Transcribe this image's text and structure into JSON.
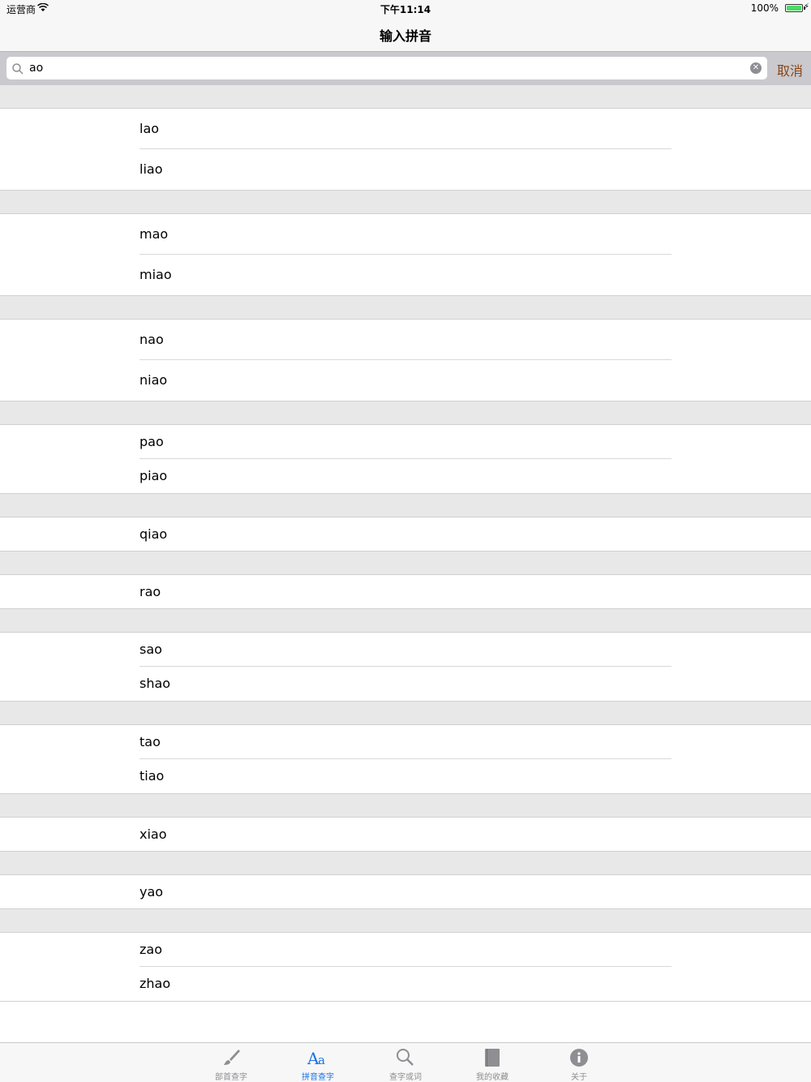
{
  "status_bar": {
    "carrier": "运营商",
    "time": "下午11:14",
    "battery": "100%"
  },
  "nav": {
    "title": "输入拼音"
  },
  "search": {
    "value": "ao",
    "cancel_label": "取消"
  },
  "list": {
    "sections": [
      {
        "items": [
          "lao",
          "liao"
        ]
      },
      {
        "items": [
          "mao",
          "miao"
        ]
      },
      {
        "items": [
          "nao",
          "niao"
        ]
      },
      {
        "items": [
          "pao",
          "piao"
        ]
      },
      {
        "items": [
          "qiao"
        ]
      },
      {
        "items": [
          "rao"
        ]
      },
      {
        "items": [
          "sao",
          "shao"
        ]
      },
      {
        "items": [
          "tao",
          "tiao"
        ]
      },
      {
        "items": [
          "xiao"
        ]
      },
      {
        "items": [
          "yao"
        ]
      },
      {
        "items": [
          "zao",
          "zhao"
        ]
      }
    ]
  },
  "tab_bar": {
    "tabs": [
      {
        "label": "部首查字",
        "icon": "brush-icon",
        "active": false
      },
      {
        "label": "拼音查字",
        "icon": "aa-icon",
        "active": true
      },
      {
        "label": "查字或词",
        "icon": "search-icon",
        "active": false
      },
      {
        "label": "我的收藏",
        "icon": "book-icon",
        "active": false
      },
      {
        "label": "关于",
        "icon": "info-icon",
        "active": false
      }
    ]
  },
  "colors": {
    "accent": "#1a73e8",
    "cancel": "#8b4513",
    "section": "#e8e8e8"
  }
}
